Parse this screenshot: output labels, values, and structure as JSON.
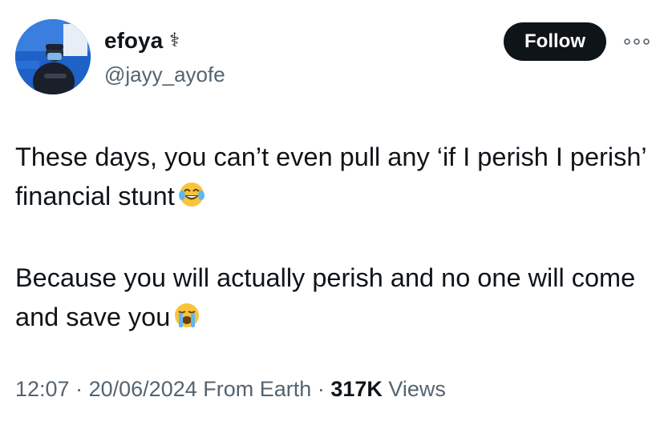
{
  "author": {
    "display_name": "efoya",
    "badge": "⚕",
    "handle": "@jayy_ayofe"
  },
  "actions": {
    "follow_label": "Follow",
    "more_icon": "more-horizontal-icon"
  },
  "tweet": {
    "paragraph_1": "These days, you can’t even pull any ‘if I perish I perish’ financial stunt",
    "paragraph_1_emoji": "face-with-tears-of-joy",
    "paragraph_2": "Because you will actually perish and no one will come and save you",
    "paragraph_2_emoji": "loudly-crying-face"
  },
  "meta": {
    "time": "12:07",
    "separator": "·",
    "date": "20/06/2024",
    "source": "From Earth",
    "views_count": "317K",
    "views_label": "Views"
  },
  "colors": {
    "text_primary": "#0f1419",
    "text_secondary": "#536471",
    "button_bg": "#0f1419"
  }
}
